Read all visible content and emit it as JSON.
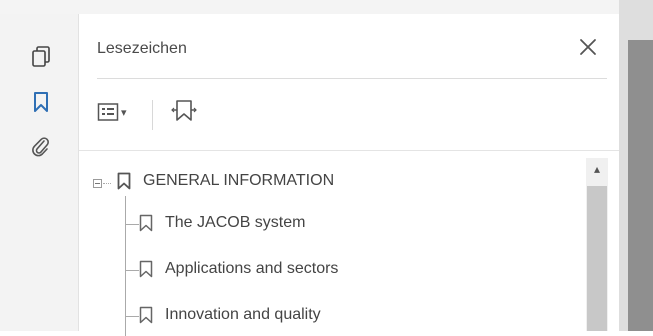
{
  "left_rail": {
    "icons": [
      "page-thumbnails-icon",
      "bookmark-icon",
      "paperclip-icon"
    ],
    "active": "bookmark-icon",
    "accent_color": "#2f6fb4"
  },
  "panel": {
    "title": "Lesezeichen",
    "close_glyph": "✕",
    "toolbar": {
      "options_icon": "list-options-icon",
      "options_arrow": "▾",
      "expand_icon": "bookmark-tag-icon"
    }
  },
  "bookmarks": {
    "root": {
      "label": "GENERAL INFORMATION",
      "expanded": true
    },
    "children": [
      {
        "label": "The JACOB system"
      },
      {
        "label": "Applications and sectors"
      },
      {
        "label": "Innovation and quality"
      }
    ]
  },
  "scrollbar": {
    "up_glyph": "▴"
  }
}
